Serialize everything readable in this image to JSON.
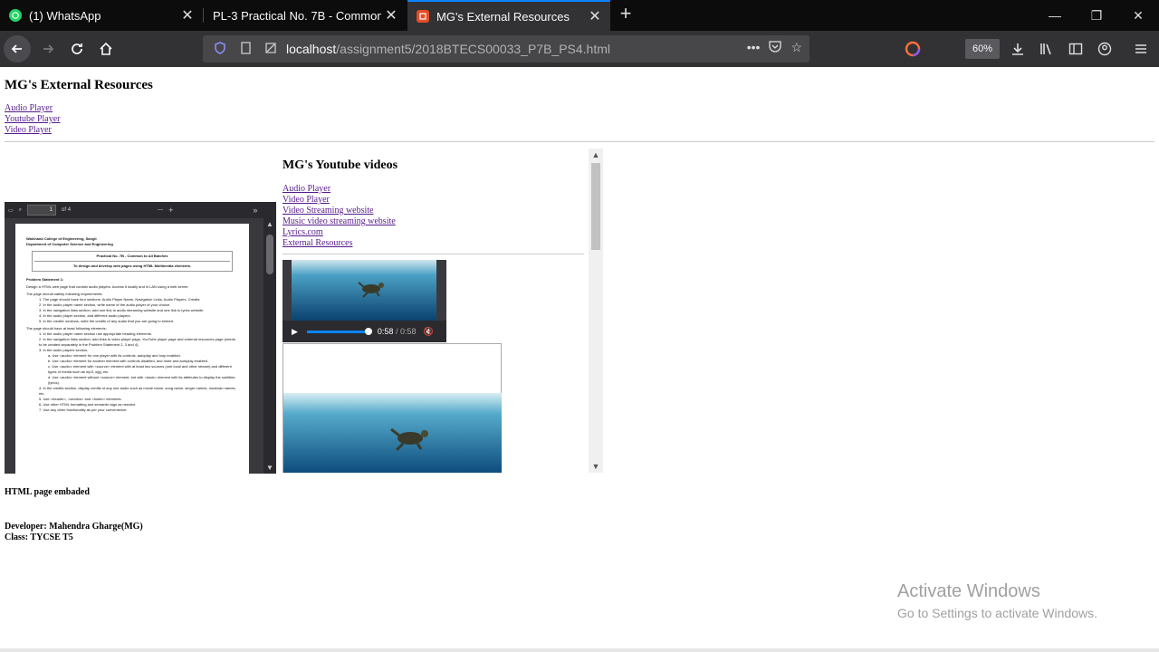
{
  "browser": {
    "tabs": [
      {
        "title": "(1) WhatsApp",
        "icon": "whatsapp-icon",
        "icon_color": "#25d366"
      },
      {
        "title": "PL-3 Practical No. 7B - Common to",
        "icon": "",
        "icon_color": ""
      },
      {
        "title": "MG's External Resources",
        "icon": "html-file-icon",
        "icon_color": "#e44d26",
        "active": true
      }
    ],
    "url_host": "localhost",
    "url_path": "/assignment5/2018BTECS00033_P7B_PS4.html",
    "zoom": "60%"
  },
  "page": {
    "title": "MG's External Resources",
    "top_links": [
      "Audio Player",
      "Youtube Player",
      "Video Player"
    ],
    "pdf": {
      "page_number": "1",
      "page_count": "of 4",
      "header_lines": [
        "Walchand College of Engineering, Sangli",
        "Department of Computer Science and Engineering"
      ],
      "box_title": "Practical No. 7B - Common to All Batches",
      "box_subtitle": "To design and develop web pages using HTML Multimedia elements.",
      "problem_heading": "Problem Statement 1:",
      "paragraphs": [
        "Design a HTML web page that contain audio players. Access it locally and in LAN using a web server.",
        "The page should satisfy following requirements:"
      ],
      "list_items": [
        "1. The page should have four sections: Audio Player Name, Navigation Links, Audio Players, Credits.",
        "2. In the audio player name section, write name of the audio player of your choice.",
        "3. In the navigation links section, add one link to audio streaming website and one link to lyrics website.",
        "4. In the audio player section, add different audio players.",
        "5. In the credits' sections, write the credits of any audio that you are going to embed."
      ],
      "paragraph2": "The page should have at least following elements:",
      "list_items2": [
        "1. In the audio player name section use appropriate heading elements.",
        "2. In the navigation links section, add links to video player page, YouTube player page and external resources page (needs to be created separately in the Problem Statement 2, 3 and 4).",
        "3. In the audio players section,",
        "a. Use <audio> element for one player with its controls, autoplay and loop enabled.",
        "b. Use <audio> element for another element with controls disabled, and mute and autoplay enabled.",
        "c. Use <audio> element with <source> element with at least two sources (one local and other stream) and different types of media such as mp3, ogg, etc.",
        "d. Use <audio> element without <source> element, but with <track> element with its attributes to display the subtitles (lyrics).",
        "4. In the credits section, display credits of any one audio such as movie name, song name, singer names, musician names, etc.",
        "5. Use <header>, <section> and <footer> elements.",
        "6. Use other HTML formatting and semantic tags as needed.",
        "7. Use any other functionality as per your convenience."
      ]
    },
    "youtube_section": {
      "heading": "MG's Youtube videos",
      "links": [
        "Audio Player",
        "Video Player",
        "Video Streaming website",
        "Music video streaming website",
        "Lyrics.com",
        "External Resources"
      ],
      "video1": {
        "current_time": "0:58",
        "duration": "/ 0:58",
        "progress_fraction": 1.0
      }
    },
    "caption": "HTML page embaded",
    "footer_developer": "Developer: Mahendra Gharge(MG)",
    "footer_class": "Class: TYCSE T5"
  },
  "watermark": {
    "line1": "Activate Windows",
    "line2": "Go to Settings to activate Windows."
  }
}
